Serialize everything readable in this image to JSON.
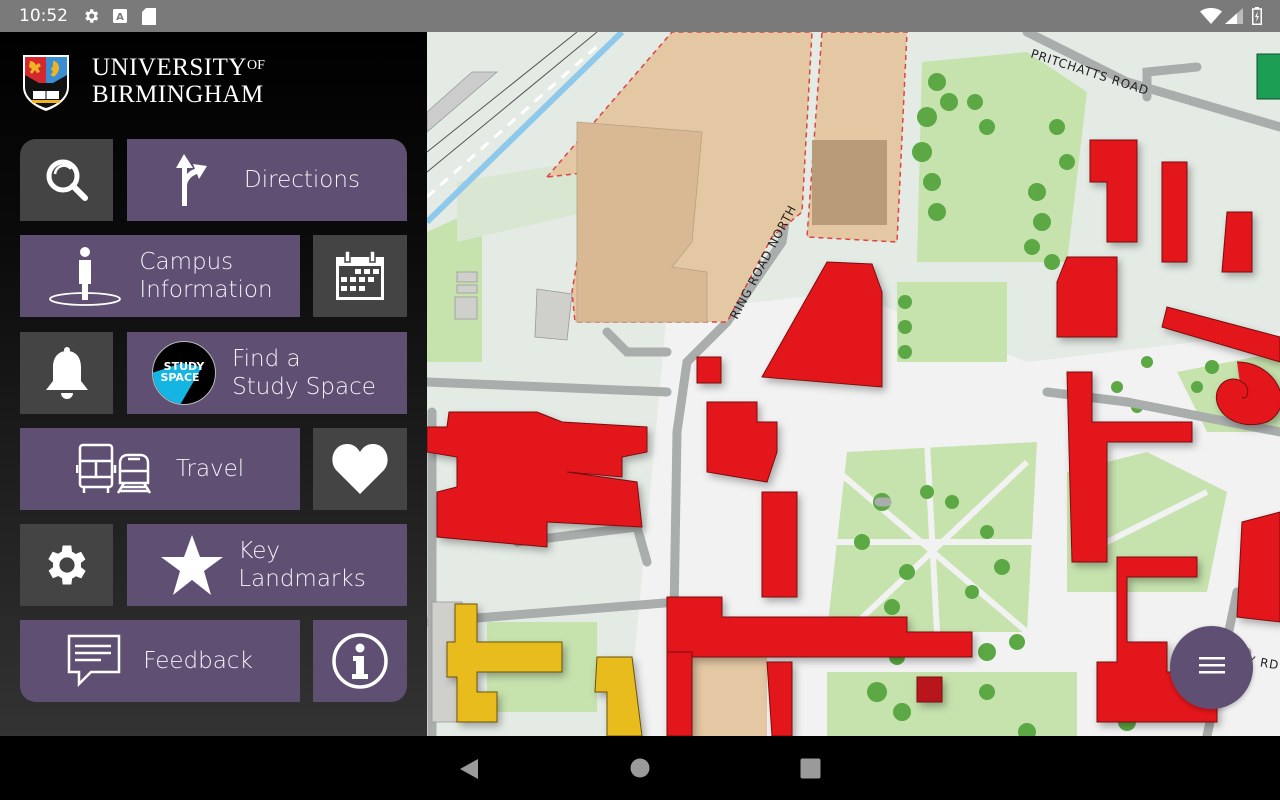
{
  "status_bar": {
    "time": "10:52",
    "left_icons": [
      "settings-icon",
      "accessibility-a-icon",
      "sd-card-icon"
    ],
    "right_icons": [
      "wifi-icon",
      "signal-icon",
      "battery-charging-icon"
    ]
  },
  "sidebar": {
    "brand": {
      "line1": "UNIVERSITY",
      "of": "OF",
      "line2": "BIRMINGHAM",
      "logo": "university-crest-icon"
    },
    "tiles": [
      {
        "id": "search",
        "label": "",
        "icon": "search-icon",
        "style": "dark"
      },
      {
        "id": "directions",
        "label": "Directions",
        "icon": "directions-fork-icon",
        "style": "purple"
      },
      {
        "id": "campus-information",
        "label_line1": "Campus",
        "label_line2": "Information",
        "icon": "person-pin-icon",
        "style": "purple"
      },
      {
        "id": "calendar",
        "label": "",
        "icon": "calendar-icon",
        "style": "dark"
      },
      {
        "id": "notifications",
        "label": "",
        "icon": "bell-icon",
        "style": "dark"
      },
      {
        "id": "study-space",
        "label_line1": "Find a",
        "label_line2": "Study Space",
        "icon": "study-space-logo-icon",
        "logo_text_1": "STUDY",
        "logo_text_2": "SPACE",
        "style": "purple"
      },
      {
        "id": "travel",
        "label": "Travel",
        "icon": "bus-train-icon",
        "style": "purple"
      },
      {
        "id": "favourites",
        "label": "",
        "icon": "heart-icon",
        "style": "dark"
      },
      {
        "id": "settings",
        "label": "",
        "icon": "gear-icon",
        "style": "dark"
      },
      {
        "id": "key-landmarks",
        "label_line1": "Key",
        "label_line2": "Landmarks",
        "icon": "star-icon",
        "style": "purple"
      },
      {
        "id": "feedback",
        "label": "Feedback",
        "icon": "speech-bubble-icon",
        "style": "purple"
      },
      {
        "id": "info",
        "label": "",
        "icon": "info-icon",
        "style": "purple"
      }
    ]
  },
  "map": {
    "road_labels": [
      "PRITCHATTS ROAD",
      "RING ROAD NORTH",
      "Y RD"
    ],
    "colors": {
      "building_red": "#e3171e",
      "building_yellow": "#e8bc1a",
      "building_green": "#1e9e55",
      "grass": "#c6e2ad",
      "tree": "#5ba844",
      "construction": "#e1c4a0",
      "road": "#a9adab",
      "water": "#8ec9ec",
      "background": "#e4ebe5"
    },
    "fab": {
      "icon": "menu-hamburger-icon"
    }
  },
  "nav_bar": {
    "buttons": [
      "back-icon",
      "home-icon",
      "recents-icon"
    ]
  },
  "theme": {
    "purple": "#5f4f73",
    "dark_tile": "#444444"
  }
}
